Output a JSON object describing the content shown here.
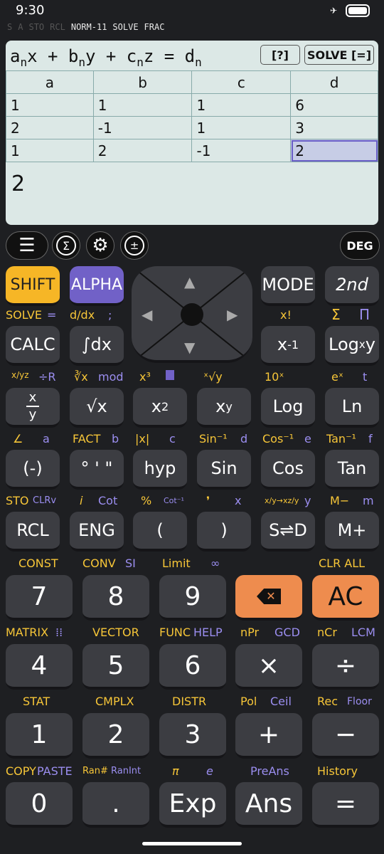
{
  "status": {
    "time": "9:30"
  },
  "indicators": {
    "dim": [
      "S",
      "A",
      "STO",
      "RCL"
    ],
    "on": [
      "NORM-11",
      "SOLVE",
      "FRAC"
    ]
  },
  "display": {
    "help_label": "[?]",
    "solve_label": "SOLVE [=]",
    "headers": [
      "a",
      "b",
      "c",
      "d"
    ],
    "rows": [
      [
        "1",
        "1",
        "1",
        "6"
      ],
      [
        "2",
        "-1",
        "1",
        "3"
      ],
      [
        "1",
        "2",
        "-1",
        "2"
      ]
    ],
    "result": "2"
  },
  "toolbar": {
    "deg_label": "DEG"
  },
  "keys": {
    "shift": "SHIFT",
    "alpha": "ALPHA",
    "mode": "MODE",
    "second": "2nd",
    "calc": "CALC",
    "integral": "∫dx",
    "inverse": "x",
    "inverse_exp": "-1",
    "logxy": "Log",
    "logxy_sub": "x",
    "logxy_end": "y",
    "frac_top": "x",
    "frac_bottom": "y",
    "sqrt": "√x",
    "square": "x",
    "square_exp": "2",
    "power": "x",
    "power_exp": "y",
    "log": "Log",
    "ln": "Ln",
    "neg": "(-)",
    "deg_min_sec": "° ' \"",
    "hyp": "hyp",
    "sin": "Sin",
    "cos": "Cos",
    "tan": "Tan",
    "rcl": "RCL",
    "eng": "ENG",
    "lparen": "(",
    "rparen": ")",
    "s_d": "S⇌D",
    "m_plus": "M+",
    "seven": "7",
    "eight": "8",
    "nine": "9",
    "ac": "AC",
    "four": "4",
    "five": "5",
    "six": "6",
    "mult": "×",
    "div": "÷",
    "one": "1",
    "two": "2",
    "three": "3",
    "plus": "+",
    "minus": "−",
    "zero": "0",
    "dot": ".",
    "exp": "Exp",
    "ans": "Ans",
    "equals": "="
  },
  "labels": {
    "solve": "SOLVE",
    "eq": "=",
    "ddx": "d/dx",
    "semi": ";",
    "fact": "x!",
    "sum": "Σ",
    "prod": "Π",
    "frac_conv": "x/yz",
    "div_r": "÷R",
    "cbrt": "∛x",
    "mod": "mod",
    "cube": "x³",
    "xroot": "ˣ√y",
    "ten_x": "10ˣ",
    "e_x": "eˣ",
    "t": "t",
    "angle": "∠",
    "a": "a",
    "fact_word": "FACT",
    "b": "b",
    "abs": "|x|",
    "c": "c",
    "asin": "Sin⁻¹",
    "d": "d",
    "acos": "Cos⁻¹",
    "e": "e",
    "atan": "Tan⁻¹",
    "f": "f",
    "sto": "STO",
    "clrv": "CLRv",
    "i": "i",
    "cot": "Cot",
    "percent": "%",
    "acot": "Cot⁻¹",
    "comma": "❜",
    "x": "x",
    "mixed": "x/y→xz/y",
    "y": "y",
    "m_minus": "M−",
    "m": "m",
    "const": "CONST",
    "conv": "CONV",
    "si": "SI",
    "limit": "Limit",
    "inf": "∞",
    "clr_all": "CLR ALL",
    "matrix": "MATRIX",
    "vector": "VECTOR",
    "func": "FUNC",
    "help": "HELP",
    "npr": "nPr",
    "gcd": "GCD",
    "ncr": "nCr",
    "lcm": "LCM",
    "stat": "STAT",
    "cmplx": "CMPLX",
    "distr": "DISTR",
    "pol": "Pol",
    "ceil": "Ceil",
    "rec": "Rec",
    "floor": "Floor",
    "copy": "COPY",
    "paste": "PASTE",
    "ran": "Ran#",
    "ranint": "RanInt",
    "pi": "π",
    "e_const": "e",
    "preans": "PreAns",
    "history": "History"
  },
  "colors": {
    "shift": "#f6b626",
    "alpha": "#7161c7",
    "orange": "#ee8c4e",
    "display": "#dce8e6",
    "key": "#3c3d42"
  }
}
